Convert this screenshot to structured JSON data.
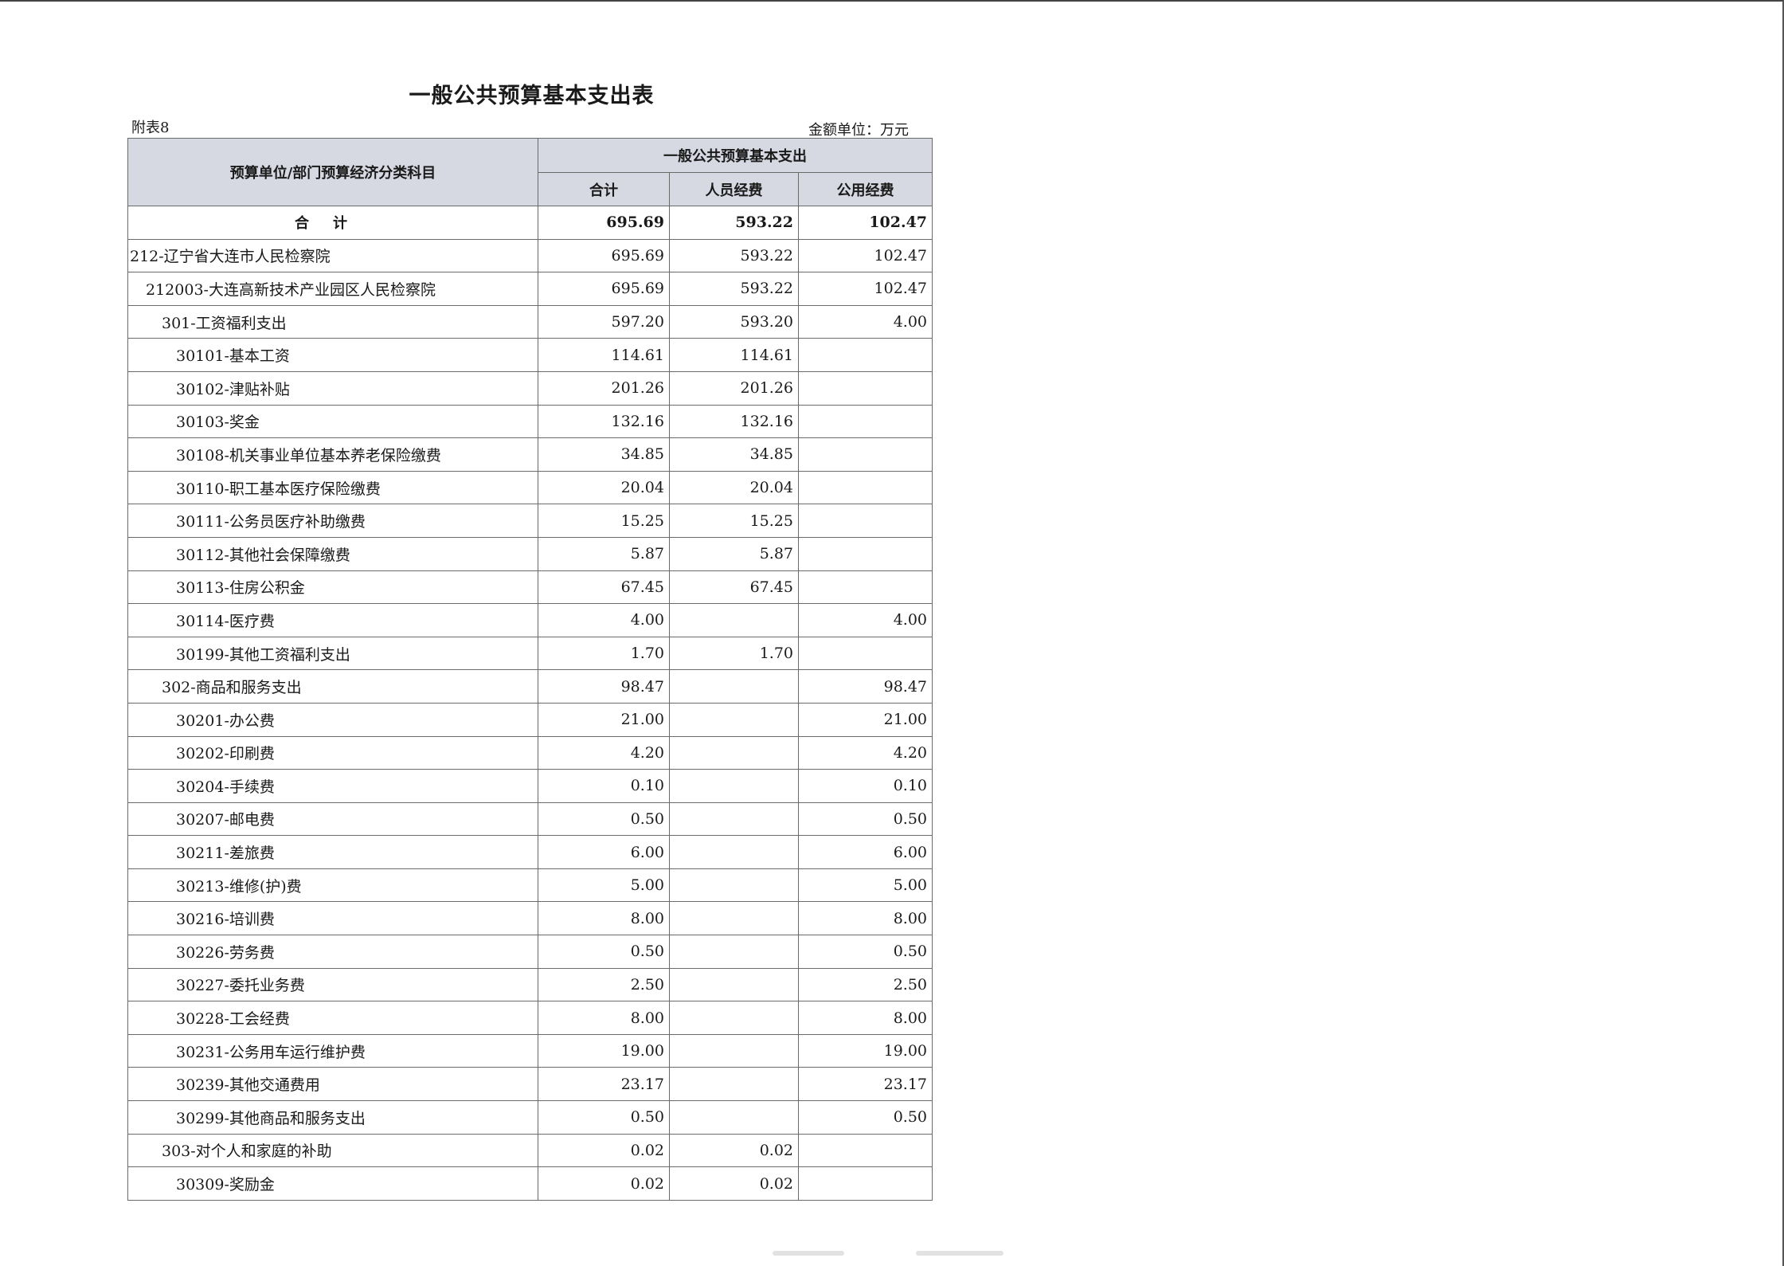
{
  "title": "一般公共预算基本支出表",
  "attachment": "附表8",
  "unit": "金额单位：万元",
  "header": {
    "row_label": "预算单位/部门预算经济分类科目",
    "group_label": "一般公共预算基本支出",
    "col_total": "合计",
    "col_personnel": "人员经费",
    "col_public": "公用经费"
  },
  "total_row": {
    "name": "合计",
    "total": "695.69",
    "personnel": "593.22",
    "public": "102.47"
  },
  "rows": [
    {
      "name": "212-辽宁省大连市人民检察院",
      "total": "695.69",
      "personnel": "593.22",
      "public": "102.47"
    },
    {
      "name": "212003-大连高新技术产业园区人民检察院",
      "total": "695.69",
      "personnel": "593.22",
      "public": "102.47"
    },
    {
      "name": "301-工资福利支出",
      "total": "597.20",
      "personnel": "593.20",
      "public": "4.00"
    },
    {
      "name": "30101-基本工资",
      "total": "114.61",
      "personnel": "114.61",
      "public": ""
    },
    {
      "name": "30102-津贴补贴",
      "total": "201.26",
      "personnel": "201.26",
      "public": ""
    },
    {
      "name": "30103-奖金",
      "total": "132.16",
      "personnel": "132.16",
      "public": ""
    },
    {
      "name": "30108-机关事业单位基本养老保险缴费",
      "total": "34.85",
      "personnel": "34.85",
      "public": ""
    },
    {
      "name": "30110-职工基本医疗保险缴费",
      "total": "20.04",
      "personnel": "20.04",
      "public": ""
    },
    {
      "name": "30111-公务员医疗补助缴费",
      "total": "15.25",
      "personnel": "15.25",
      "public": ""
    },
    {
      "name": "30112-其他社会保障缴费",
      "total": "5.87",
      "personnel": "5.87",
      "public": ""
    },
    {
      "name": "30113-住房公积金",
      "total": "67.45",
      "personnel": "67.45",
      "public": ""
    },
    {
      "name": "30114-医疗费",
      "total": "4.00",
      "personnel": "",
      "public": "4.00"
    },
    {
      "name": "30199-其他工资福利支出",
      "total": "1.70",
      "personnel": "1.70",
      "public": ""
    },
    {
      "name": "302-商品和服务支出",
      "total": "98.47",
      "personnel": "",
      "public": "98.47"
    },
    {
      "name": "30201-办公费",
      "total": "21.00",
      "personnel": "",
      "public": "21.00"
    },
    {
      "name": "30202-印刷费",
      "total": "4.20",
      "personnel": "",
      "public": "4.20"
    },
    {
      "name": "30204-手续费",
      "total": "0.10",
      "personnel": "",
      "public": "0.10"
    },
    {
      "name": "30207-邮电费",
      "total": "0.50",
      "personnel": "",
      "public": "0.50"
    },
    {
      "name": "30211-差旅费",
      "total": "6.00",
      "personnel": "",
      "public": "6.00"
    },
    {
      "name": "30213-维修(护)费",
      "total": "5.00",
      "personnel": "",
      "public": "5.00"
    },
    {
      "name": "30216-培训费",
      "total": "8.00",
      "personnel": "",
      "public": "8.00"
    },
    {
      "name": "30226-劳务费",
      "total": "0.50",
      "personnel": "",
      "public": "0.50"
    },
    {
      "name": "30227-委托业务费",
      "total": "2.50",
      "personnel": "",
      "public": "2.50"
    },
    {
      "name": "30228-工会经费",
      "total": "8.00",
      "personnel": "",
      "public": "8.00"
    },
    {
      "name": "30231-公务用车运行维护费",
      "total": "19.00",
      "personnel": "",
      "public": "19.00"
    },
    {
      "name": "30239-其他交通费用",
      "total": "23.17",
      "personnel": "",
      "public": "23.17"
    },
    {
      "name": "30299-其他商品和服务支出",
      "total": "0.50",
      "personnel": "",
      "public": "0.50"
    },
    {
      "name": "303-对个人和家庭的补助",
      "total": "0.02",
      "personnel": "0.02",
      "public": ""
    },
    {
      "name": "30309-奖励金",
      "total": "0.02",
      "personnel": "0.02",
      "public": ""
    }
  ]
}
